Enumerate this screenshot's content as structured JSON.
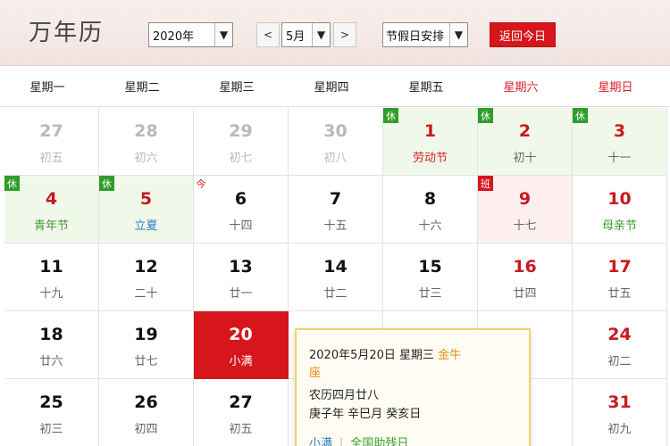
{
  "header": {
    "title": "万年历",
    "year_value": "2020年",
    "month_value": "5月",
    "prev_label": "<",
    "next_label": ">",
    "holiday_value": "节假日安排",
    "today_label": "返回今日"
  },
  "weekdays": [
    "星期一",
    "星期二",
    "星期三",
    "星期四",
    "星期五",
    "星期六",
    "星期日"
  ],
  "days": [
    {
      "num": "27",
      "sub": "初五",
      "other": true
    },
    {
      "num": "28",
      "sub": "初六",
      "other": true
    },
    {
      "num": "29",
      "sub": "初七",
      "other": true
    },
    {
      "num": "30",
      "sub": "初八",
      "other": true
    },
    {
      "num": "1",
      "sub": "劳动节",
      "badge": "休"
    },
    {
      "num": "2",
      "sub": "初十",
      "badge": "休"
    },
    {
      "num": "3",
      "sub": "十一",
      "badge": "休"
    },
    {
      "num": "4",
      "sub": "青年节",
      "badge": "休"
    },
    {
      "num": "5",
      "sub": "立夏",
      "badge": "休"
    },
    {
      "num": "6",
      "sub": "十四",
      "badge": "今"
    },
    {
      "num": "7",
      "sub": "十五"
    },
    {
      "num": "8",
      "sub": "十六"
    },
    {
      "num": "9",
      "sub": "十七",
      "badge": "班"
    },
    {
      "num": "10",
      "sub": "母亲节"
    },
    {
      "num": "11",
      "sub": "十九"
    },
    {
      "num": "12",
      "sub": "二十"
    },
    {
      "num": "13",
      "sub": "廿一"
    },
    {
      "num": "14",
      "sub": "廿二"
    },
    {
      "num": "15",
      "sub": "廿三"
    },
    {
      "num": "16",
      "sub": "廿四"
    },
    {
      "num": "17",
      "sub": "廿五"
    },
    {
      "num": "18",
      "sub": "廿六"
    },
    {
      "num": "19",
      "sub": "廿七"
    },
    {
      "num": "20",
      "sub": "小满"
    },
    {
      "num": "24",
      "sub": "初二"
    },
    {
      "num": "25",
      "sub": "初三"
    },
    {
      "num": "26",
      "sub": "初四"
    },
    {
      "num": "27",
      "sub": "初五"
    },
    {
      "num": "31",
      "sub": "初九"
    }
  ],
  "popup": {
    "date_line": "2020年5月20日 星期三",
    "zodiac_a": "金牛",
    "zodiac_b": "座",
    "lunar": "农历四月廿八",
    "ganzhi": "庚子年 辛巳月 癸亥日",
    "term": "小满",
    "event": "全国助残日"
  },
  "colors": {
    "accent_red": "#d7161c",
    "rest_green": "#2f9d2a",
    "festival_green": "#3b9a2f",
    "holiday_bg": "#f0f8ea"
  }
}
